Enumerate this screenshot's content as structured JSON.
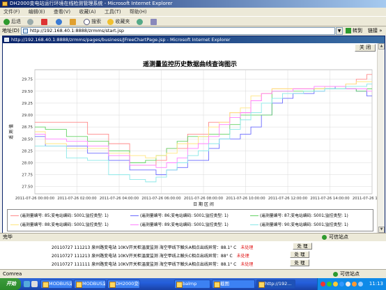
{
  "outer_window": {
    "title": "DH2000变电站运行环境在线检测管理系统 - Microsoft Internet Explorer"
  },
  "menu": [
    "文件(F)",
    "编辑(E)",
    "查看(V)",
    "收藏(A)",
    "工具(T)",
    "帮助(H)"
  ],
  "toolbar": {
    "back": "后退",
    "search": "搜索",
    "favorites": "收藏夹"
  },
  "address": {
    "label": "地址(D)",
    "url": "http://192.168.40.1:8888/zrmms/start.jsp",
    "go": "转到",
    "links": "链接 »"
  },
  "popup": {
    "title": "http://192.168.40.1:8888/zrmms/pages/business/JFreeChartPage.jsp - Microsoft Internet Explorer",
    "close_label": "关 闭"
  },
  "chart_data": {
    "type": "line",
    "title": "遥测量监控历史数据曲线查询图示",
    "xlabel": "日 期 区 间",
    "ylabel": "遥 测 值",
    "ylim": [
      27.35,
      29.95
    ],
    "y_ticks": [
      "29.75",
      "29.50",
      "29.25",
      "29.00",
      "28.75",
      "28.50",
      "28.25",
      "28.00",
      "27.75",
      "27.50"
    ],
    "x_ticks": [
      "2011-07-26 00:00:00",
      "2011-07-26 02:00:00",
      "2011-07-26 04:00:00",
      "2011-07-26 06:00:00",
      "2011-07-26 08:00:00",
      "2011-07-26 10:00:00",
      "2011-07-26 12:00:00",
      "2011-07-26 14:00:00",
      "2011-07-26 16:00:00"
    ],
    "x_hours": [
      0,
      1,
      2,
      3,
      4,
      5,
      5.5,
      6,
      6.5,
      7,
      7.5,
      8,
      8.5,
      9,
      9.5,
      10,
      10.5,
      11,
      11.5,
      12,
      12.5,
      13,
      13.5,
      14,
      14.5,
      15,
      15.5,
      16
    ],
    "series": [
      {
        "name": "(遥测量编号: 85;变电站编码: S001;监控类型: 1)",
        "color": "#ff8a8a",
        "values": [
          28.85,
          28.85,
          28.85,
          28.6,
          28.4,
          27.95,
          27.95,
          28.05,
          28.3,
          28.3,
          28.6,
          28.6,
          28.85,
          28.85,
          29.05,
          29.05,
          29.3,
          29.45,
          29.55,
          29.55,
          29.55,
          29.55,
          29.55,
          29.6,
          29.6,
          29.65,
          29.75,
          29.85
        ]
      },
      {
        "name": "(遥测量编号: 86;变电站编码: S001;监控类型: 1)",
        "color": "#6a6aff",
        "values": [
          28.55,
          28.35,
          28.35,
          28.2,
          28.05,
          27.85,
          27.85,
          27.75,
          27.85,
          27.9,
          28.05,
          28.05,
          28.3,
          28.5,
          28.5,
          28.6,
          28.75,
          29.0,
          29.25,
          29.35,
          29.45,
          29.45,
          29.5,
          29.55,
          29.6,
          29.55,
          29.5,
          29.4
        ]
      },
      {
        "name": "(遥测量编号: 87;变电站编码: S001;监控类型: 1)",
        "color": "#64d264",
        "values": [
          28.75,
          28.7,
          28.55,
          28.45,
          28.25,
          28.0,
          28.05,
          28.15,
          28.3,
          28.45,
          28.55,
          28.55,
          28.6,
          28.6,
          28.8,
          29.0,
          29.0,
          29.0,
          29.5,
          29.5,
          29.5,
          29.5,
          29.55,
          29.55,
          29.55,
          29.55,
          29.5,
          29.55
        ]
      },
      {
        "name": "(遥测量编号: 88;变电站编码: S001;监控类型: 1)",
        "color": "#ffe680",
        "values": [
          28.65,
          28.4,
          28.3,
          28.3,
          28.2,
          28.15,
          28.1,
          28.15,
          28.2,
          28.4,
          28.4,
          28.55,
          28.75,
          28.85,
          29.05,
          29.15,
          29.4,
          29.45,
          29.55,
          29.55,
          29.55,
          29.55,
          29.55,
          29.6,
          29.6,
          29.65,
          29.7,
          29.7
        ]
      },
      {
        "name": "(遥测量编号: 89;变电站编码: S001;监控类型: 1)",
        "color": "#ff80ff",
        "values": [
          28.6,
          28.5,
          28.45,
          28.35,
          28.15,
          27.95,
          27.95,
          27.9,
          28.0,
          28.1,
          28.3,
          28.4,
          28.55,
          28.8,
          28.95,
          29.05,
          29.3,
          29.45,
          29.5,
          29.5,
          29.55,
          29.55,
          29.6,
          29.6,
          29.6,
          29.55,
          29.55,
          29.5
        ]
      },
      {
        "name": "(遥测量编号: 90;变电站编码: S001;监控类型: 1)",
        "color": "#8ae8e8",
        "values": [
          28.35,
          28.35,
          28.1,
          28.05,
          27.75,
          27.65,
          27.6,
          27.7,
          27.85,
          28.0,
          28.15,
          28.25,
          28.4,
          28.5,
          28.7,
          28.9,
          29.05,
          29.25,
          29.35,
          29.45,
          29.45,
          29.5,
          29.5,
          29.55,
          29.55,
          29.6,
          29.6,
          29.65
        ]
      }
    ]
  },
  "status": {
    "done": "完毕",
    "zone": "可信站点"
  },
  "alarms": [
    {
      "text": "20110727 111213 泉州路变电站 10KV开关柜温度监测 海空甲线下触头A相点出线异常：88.1° C",
      "status": "未处理",
      "button": "处 理"
    },
    {
      "text": "20110727 111213 泉州路变电站 10KV开关柜温度监测 海空甲线上触头C相点出线异常：88° C",
      "status": "未处理",
      "button": "处 理"
    },
    {
      "text": "20110727 111111 泉州路变电站 10KV开关柜温度监测 海空甲线下触头A相点出线异常：88.1° C",
      "status": "未处理",
      "button": "处 理"
    }
  ],
  "status2": {
    "left": "Comrea",
    "zone": "可信站点"
  },
  "taskbar": {
    "start": "开始",
    "tasks": [
      "MODBUS采集软件",
      "MODBUS采集软件",
      "DH2000变电...",
      "balmp",
      "截图",
      "http://192..."
    ],
    "clock": "11:13"
  }
}
